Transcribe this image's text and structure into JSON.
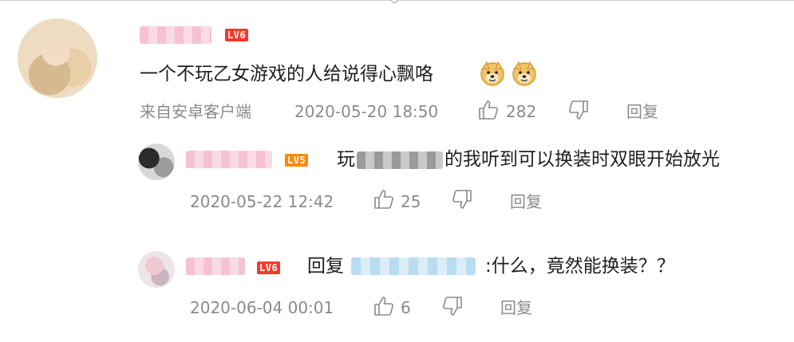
{
  "colors": {
    "lv6_badge": "#f23a2e",
    "lv5_badge": "#ff8a00",
    "meta_text": "#8a8a8a",
    "body_text": "#1f1f1f"
  },
  "main_comment": {
    "badge": "LV6",
    "text": "一个不玩乙女游戏的人给说得心飘咯",
    "emojis": [
      "doge-icon",
      "doge-icon"
    ],
    "source": "来自安卓客户端",
    "timestamp": "2020-05-20 18:50",
    "likes": "282",
    "reply_label": "回复"
  },
  "replies": [
    {
      "badge": "LV5",
      "text_prefix": "玩",
      "text_suffix": "的我听到可以换装时双眼开始放光",
      "timestamp": "2020-05-22 12:42",
      "likes": "25",
      "reply_label": "回复"
    },
    {
      "badge": "LV6",
      "reply_prefix": "回复",
      "text": ":什么，竟然能换装？？",
      "timestamp": "2020-06-04 00:01",
      "likes": "6",
      "reply_label": "回复"
    }
  ]
}
